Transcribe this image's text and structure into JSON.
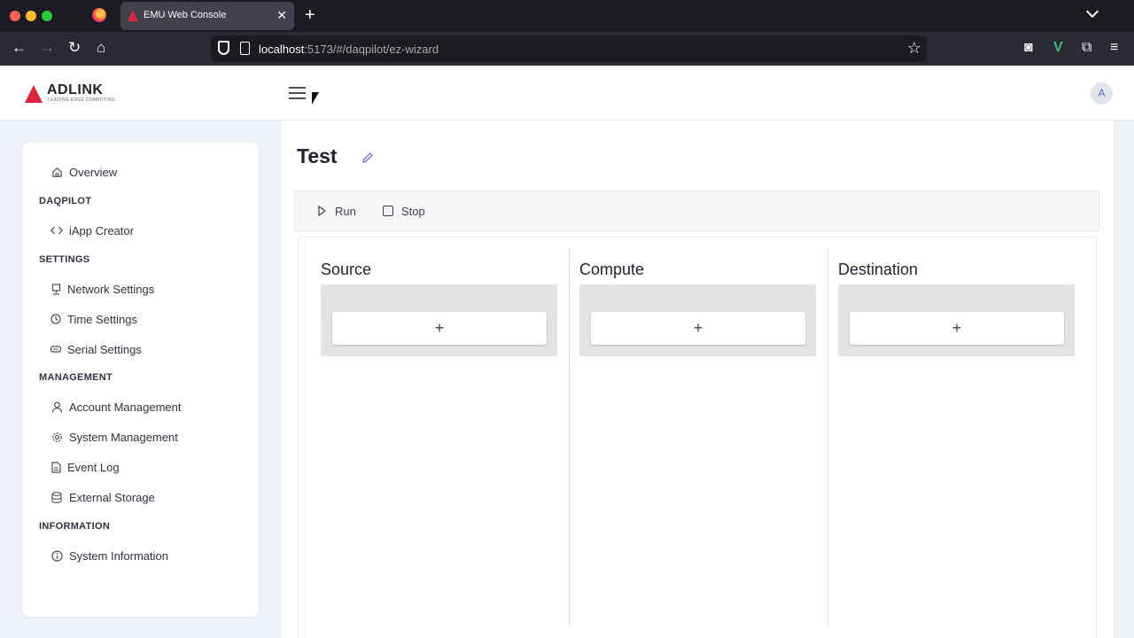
{
  "browser": {
    "tab_title": "EMU Web Console",
    "tab_close": "✕",
    "new_tab": "+",
    "url_host": "localhost",
    "url_rest": ":5173/#/daqpilot/ez-wizard"
  },
  "header": {
    "logo_text": "ADLINK",
    "logo_tagline": "LEADING EDGE COMPUTING",
    "avatar_initial": "A"
  },
  "sidebar": {
    "overview": "Overview",
    "section_daqpilot": "DAQPILOT",
    "iapp_creator": "iApp Creator",
    "section_settings": "SETTINGS",
    "network_settings": "Network Settings",
    "time_settings": "Time Settings",
    "serial_settings": "Serial Settings",
    "section_management": "MANAGEMENT",
    "account_management": "Account Management",
    "system_management": "System Management",
    "event_log": "Event Log",
    "external_storage": "External Storage",
    "section_information": "INFORMATION",
    "system_information": "System Information"
  },
  "main": {
    "title": "Test",
    "run_label": "Run",
    "stop_label": "Stop",
    "columns": [
      {
        "title": "Source",
        "add": "+"
      },
      {
        "title": "Compute",
        "add": "+"
      },
      {
        "title": "Destination",
        "add": "+"
      }
    ]
  },
  "colors": {
    "brand_red": "#d7263d",
    "accent": "#5b6ccf",
    "app_bg": "#eef1f8"
  }
}
